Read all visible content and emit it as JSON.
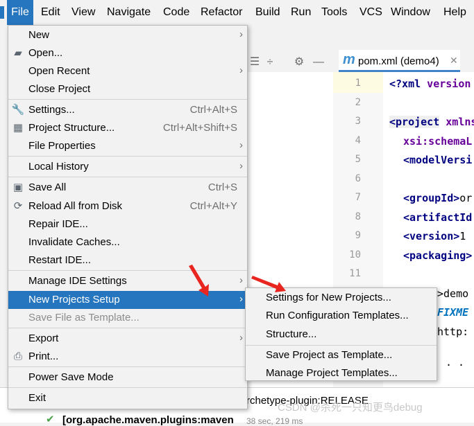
{
  "menubar": {
    "items": [
      "File",
      "Edit",
      "View",
      "Navigate",
      "Code",
      "Refactor",
      "Build",
      "Run",
      "Tools",
      "VCS",
      "Window",
      "Help"
    ],
    "active": "File"
  },
  "editor": {
    "tab_label": "pom.xml (demo4)",
    "tab_icon": "m",
    "line_numbers": [
      "1",
      "2",
      "3",
      "4",
      "5",
      "6",
      "7",
      "8",
      "9",
      "10",
      "11"
    ]
  },
  "code": {
    "l1_tag": "<?xml",
    "l1_attr": " version",
    "l3_tag": "<project",
    "l3_attr": " xmlns",
    "l4_attr": "xsi:schemaL",
    "l5_tag": "<modelVersi",
    "l7_tag": "<groupId>",
    "l7_text": "or",
    "l8_tag": "<artifactId",
    "l9_tag": "<version>",
    "l9_text": "1",
    "l10_tag": "<packaging>",
    "l12_text": ">demo",
    "l13_fixme": "FIXME",
    "l14_text": "http:",
    "l16_text": ". ."
  },
  "file_menu": {
    "items": [
      {
        "label": "New",
        "submenu": true
      },
      {
        "label": "Open...",
        "icon": "folder-icon"
      },
      {
        "label": "Open Recent",
        "submenu": true
      },
      {
        "label": "Close Project"
      },
      {
        "label": "Settings...",
        "shortcut": "Ctrl+Alt+S",
        "icon": "wrench-icon"
      },
      {
        "label": "Project Structure...",
        "shortcut": "Ctrl+Alt+Shift+S",
        "icon": "project-structure-icon"
      },
      {
        "label": "File Properties",
        "submenu": true
      },
      {
        "label": "Local History",
        "submenu": true
      },
      {
        "label": "Save All",
        "shortcut": "Ctrl+S",
        "icon": "save-icon"
      },
      {
        "label": "Reload All from Disk",
        "shortcut": "Ctrl+Alt+Y",
        "icon": "reload-icon"
      },
      {
        "label": "Repair IDE..."
      },
      {
        "label": "Invalidate Caches..."
      },
      {
        "label": "Restart IDE..."
      },
      {
        "label": "Manage IDE Settings",
        "submenu": true
      },
      {
        "label": "New Projects Setup",
        "submenu": true,
        "selected": true
      },
      {
        "label": "Save File as Template...",
        "disabled": true
      },
      {
        "label": "Export",
        "submenu": true
      },
      {
        "label": "Print...",
        "icon": "print-icon"
      },
      {
        "label": "Power Save Mode"
      },
      {
        "label": "Exit"
      }
    ]
  },
  "submenu": {
    "items": [
      "Settings for New Projects...",
      "Run Configuration Templates...",
      "Structure...",
      "Save Project as Template...",
      "Manage Project Templates..."
    ]
  },
  "bottom": {
    "line1": "rchetype-plugin:RELEASE",
    "line2": "[org.apache.maven.plugins:maven",
    "line2_meta": "38 sec, 219 ms"
  },
  "watermark": "CSDN @杀死一只知更鸟debug",
  "colors": {
    "accent": "#2675bf",
    "arrow": "#e8261f"
  }
}
